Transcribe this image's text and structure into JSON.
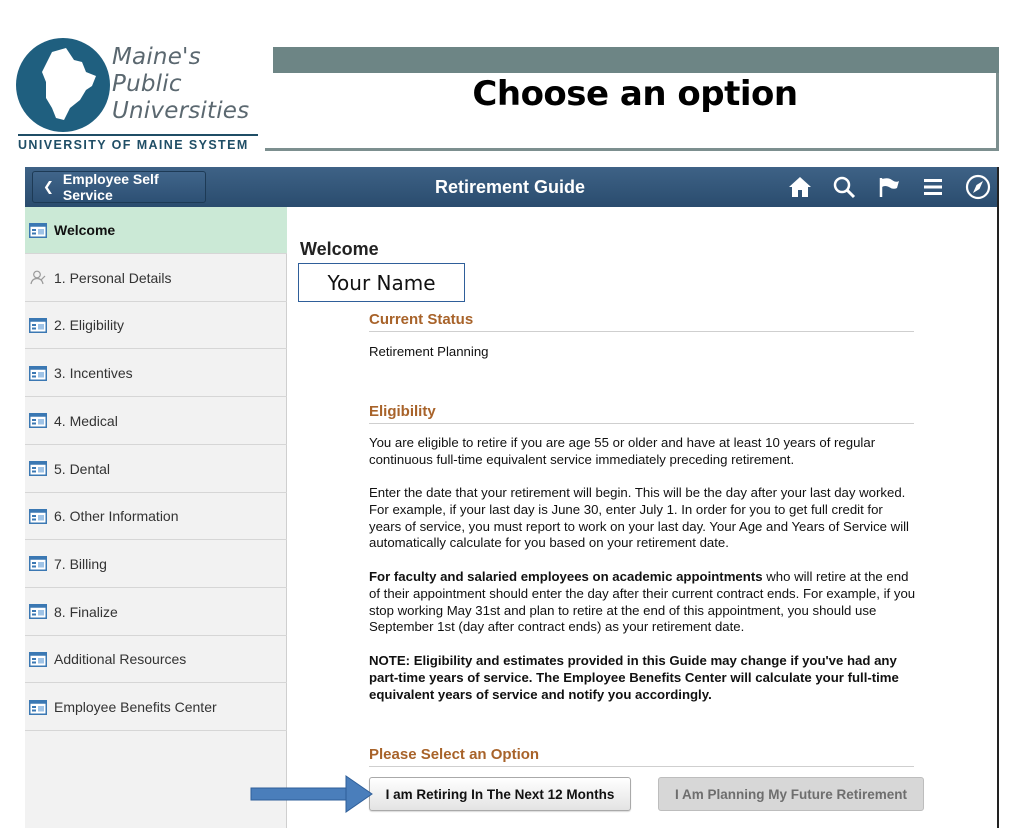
{
  "slide": {
    "title": "Choose an option",
    "logo": {
      "line1": "Maine's",
      "line2": "Public",
      "line3": "Universities",
      "system": "UNIVERSITY OF MAINE SYSTEM"
    }
  },
  "banner": {
    "back_label": "Employee Self Service",
    "title": "Retirement Guide",
    "icons": [
      "home-icon",
      "search-icon",
      "flag-icon",
      "menu-icon",
      "compass-icon"
    ]
  },
  "sidebar": {
    "items": [
      {
        "label": "Welcome",
        "icon": "page-icon",
        "active": true
      },
      {
        "label": "1. Personal Details",
        "icon": "person-icon",
        "active": false
      },
      {
        "label": "2. Eligibility",
        "icon": "page-icon",
        "active": false
      },
      {
        "label": "3. Incentives",
        "icon": "page-icon",
        "active": false
      },
      {
        "label": "4. Medical",
        "icon": "page-icon",
        "active": false
      },
      {
        "label": "5. Dental",
        "icon": "page-icon",
        "active": false
      },
      {
        "label": "6. Other Information",
        "icon": "page-icon",
        "active": false
      },
      {
        "label": "7. Billing",
        "icon": "page-icon",
        "active": false
      },
      {
        "label": "8. Finalize",
        "icon": "page-icon",
        "active": false
      },
      {
        "label": "Additional Resources",
        "icon": "page-icon",
        "active": false
      },
      {
        "label": "Employee Benefits Center",
        "icon": "page-icon",
        "active": false
      }
    ]
  },
  "content": {
    "heading": "Welcome",
    "name_box": "Your Name",
    "current_status": {
      "heading": "Current Status",
      "value": "Retirement Planning"
    },
    "eligibility": {
      "heading": "Eligibility",
      "p1": "You are eligible to retire if you are age 55 or older and have at least 10 years of regular continuous full-time equivalent service immediately preceding retirement.",
      "p2": "Enter the date that your retirement will begin. This will be the day after your last day worked. For example, if your last day is June 30, enter July 1. In order for you to get full credit for years of service, you must report to work on your last day. Your Age and Years of Service will automatically calculate for you based on your retirement date.",
      "p3_bold": "For faculty and salaried employees on academic appointments",
      "p3_rest": " who will retire at the end of their appointment should enter the day after their current contract ends. For example, if you stop working May 31st and plan to retire at the end of this appointment, you should use September 1st (day after contract ends) as your retirement date.",
      "note": "NOTE: Eligibility and estimates provided in this Guide may change if you've had any part-time years of service. The Employee Benefits Center will calculate your full-time equivalent years of service and notify you accordingly."
    },
    "option": {
      "heading": "Please Select an Option",
      "retire_button": "I am Retiring In The Next 12 Months",
      "future_button": "I Am Planning My Future Retirement"
    }
  },
  "colors": {
    "banner": "#2f5478",
    "active_nav": "#cbe9d6",
    "section_heading": "#a8632a",
    "header_bar": "#6d8585",
    "arrow": "#4a7ebb"
  }
}
